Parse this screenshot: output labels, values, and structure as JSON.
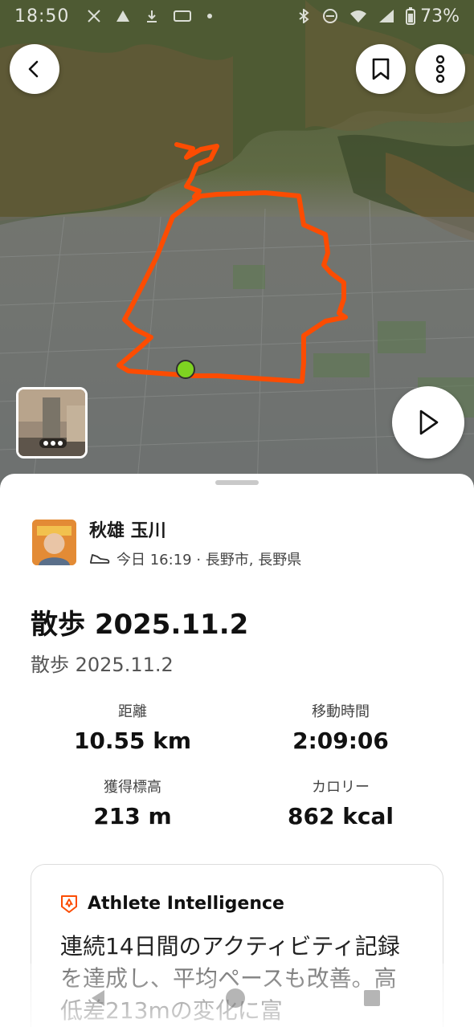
{
  "status_bar": {
    "time": "18:50",
    "battery": "73%"
  },
  "map": {
    "route_color": "#fc4c02",
    "start_marker_color": "#7ed321"
  },
  "photo_thumbnail": {
    "indicator": "more-photos"
  },
  "athlete": {
    "name": "秋雄 玉川",
    "activity_icon": "shoe-icon",
    "meta": "今日 16:19 · 長野市, 長野県"
  },
  "activity": {
    "title": "散歩 2025.11.2",
    "subtitle": "散歩 2025.11.2"
  },
  "stats": [
    {
      "label": "距離",
      "value": "10.55 km"
    },
    {
      "label": "移動時間",
      "value": "2:09:06"
    },
    {
      "label": "獲得標高",
      "value": "213 m"
    },
    {
      "label": "カロリー",
      "value": "862 kcal"
    }
  ],
  "ai_card": {
    "icon": "athlete-intelligence-icon",
    "title": "Athlete Intelligence",
    "text": "連続14日間のアクティビティ記録を達成し、平均ペースも改善。高低差213mの変化に富"
  },
  "colors": {
    "accent": "#fc4c02"
  }
}
